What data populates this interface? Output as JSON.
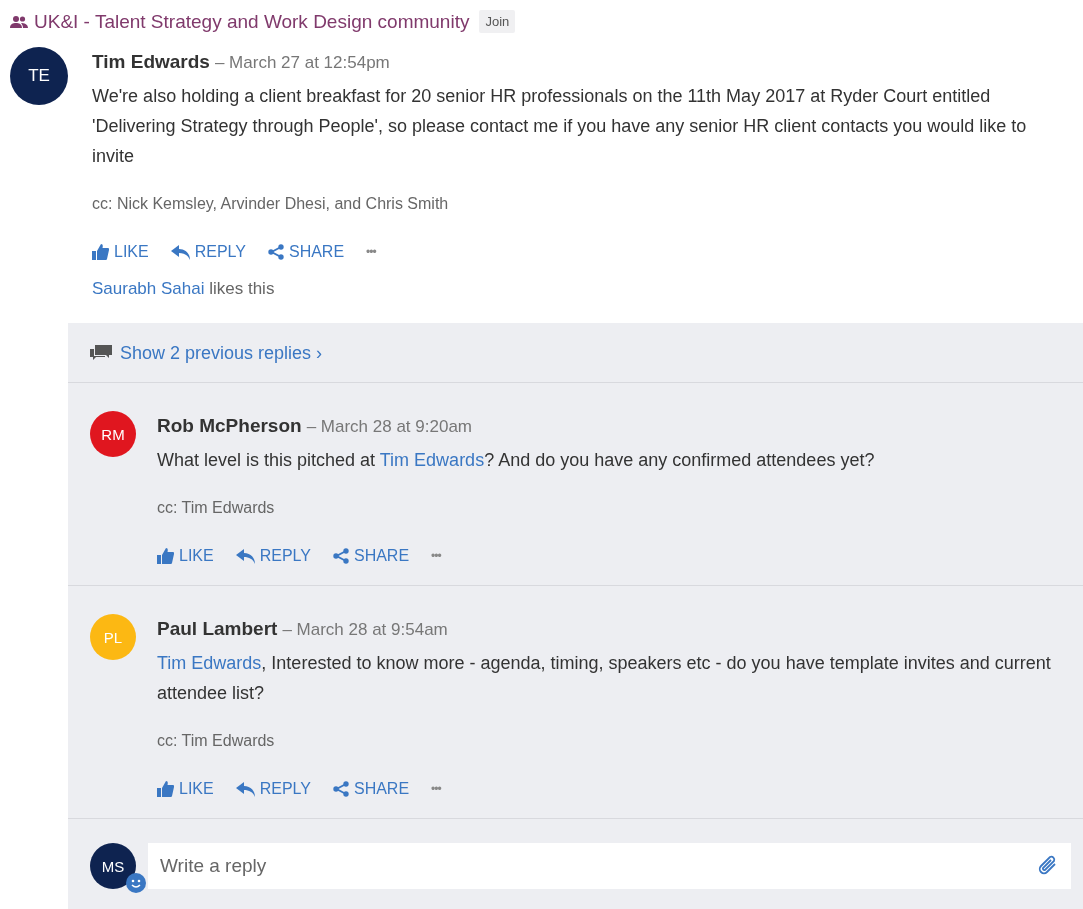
{
  "community": {
    "name": "UK&I - Talent Strategy and Work Design community",
    "join_label": "Join"
  },
  "post": {
    "initials": "TE",
    "color": "#0e2350",
    "author": "Tim Edwards",
    "separator": "–",
    "time": "March 27 at 12:54pm",
    "body": "We're also holding a client breakfast for 20 senior HR professionals on the 11th May 2017 at Ryder Court entitled 'Delivering Strategy through People', so please contact me if you have any senior HR client contacts you would like to invite",
    "cc": "cc: Nick Kemsley, Arvinder Dhesi, and Chris Smith",
    "actions": [
      {
        "kind": "like",
        "label": "LIKE"
      },
      {
        "kind": "reply",
        "label": "REPLY"
      },
      {
        "kind": "share",
        "label": "SHARE"
      },
      {
        "kind": "more",
        "label": "•••"
      }
    ],
    "likes": [
      {
        "kind": "mention",
        "text": "Saurabh Sahai"
      },
      {
        "kind": "text",
        "text": " likes this"
      }
    ]
  },
  "show_previous": "Show 2 previous replies ›",
  "replies": [
    {
      "initials": "RM",
      "color": "#e0161f",
      "author": "Rob McPherson",
      "separator": "–",
      "time": "March 28 at 9:20am",
      "body": [
        {
          "kind": "text",
          "text": "What level is this pitched at "
        },
        {
          "kind": "mention",
          "text": "Tim Edwards"
        },
        {
          "kind": "text",
          "text": "? And do you have any confirmed attendees yet?"
        }
      ],
      "cc": "cc: Tim Edwards",
      "actions": [
        {
          "kind": "like",
          "label": "LIKE"
        },
        {
          "kind": "reply",
          "label": "REPLY"
        },
        {
          "kind": "share",
          "label": "SHARE"
        },
        {
          "kind": "more",
          "label": "•••"
        }
      ]
    },
    {
      "initials": "PL",
      "color": "#fcb813",
      "author": "Paul Lambert",
      "separator": "–",
      "time": "March 28 at 9:54am",
      "body": [
        {
          "kind": "mention",
          "text": "Tim Edwards"
        },
        {
          "kind": "text",
          "text": ", Interested to know more - agenda, timing, speakers etc - do you have template invites and current attendee list?"
        }
      ],
      "cc": "cc: Tim Edwards",
      "actions": [
        {
          "kind": "like",
          "label": "LIKE"
        },
        {
          "kind": "reply",
          "label": "REPLY"
        },
        {
          "kind": "share",
          "label": "SHARE"
        },
        {
          "kind": "more",
          "label": "•••"
        }
      ]
    }
  ],
  "composer": {
    "initials": "MS",
    "color": "#0e2350",
    "placeholder": "Write a reply"
  }
}
